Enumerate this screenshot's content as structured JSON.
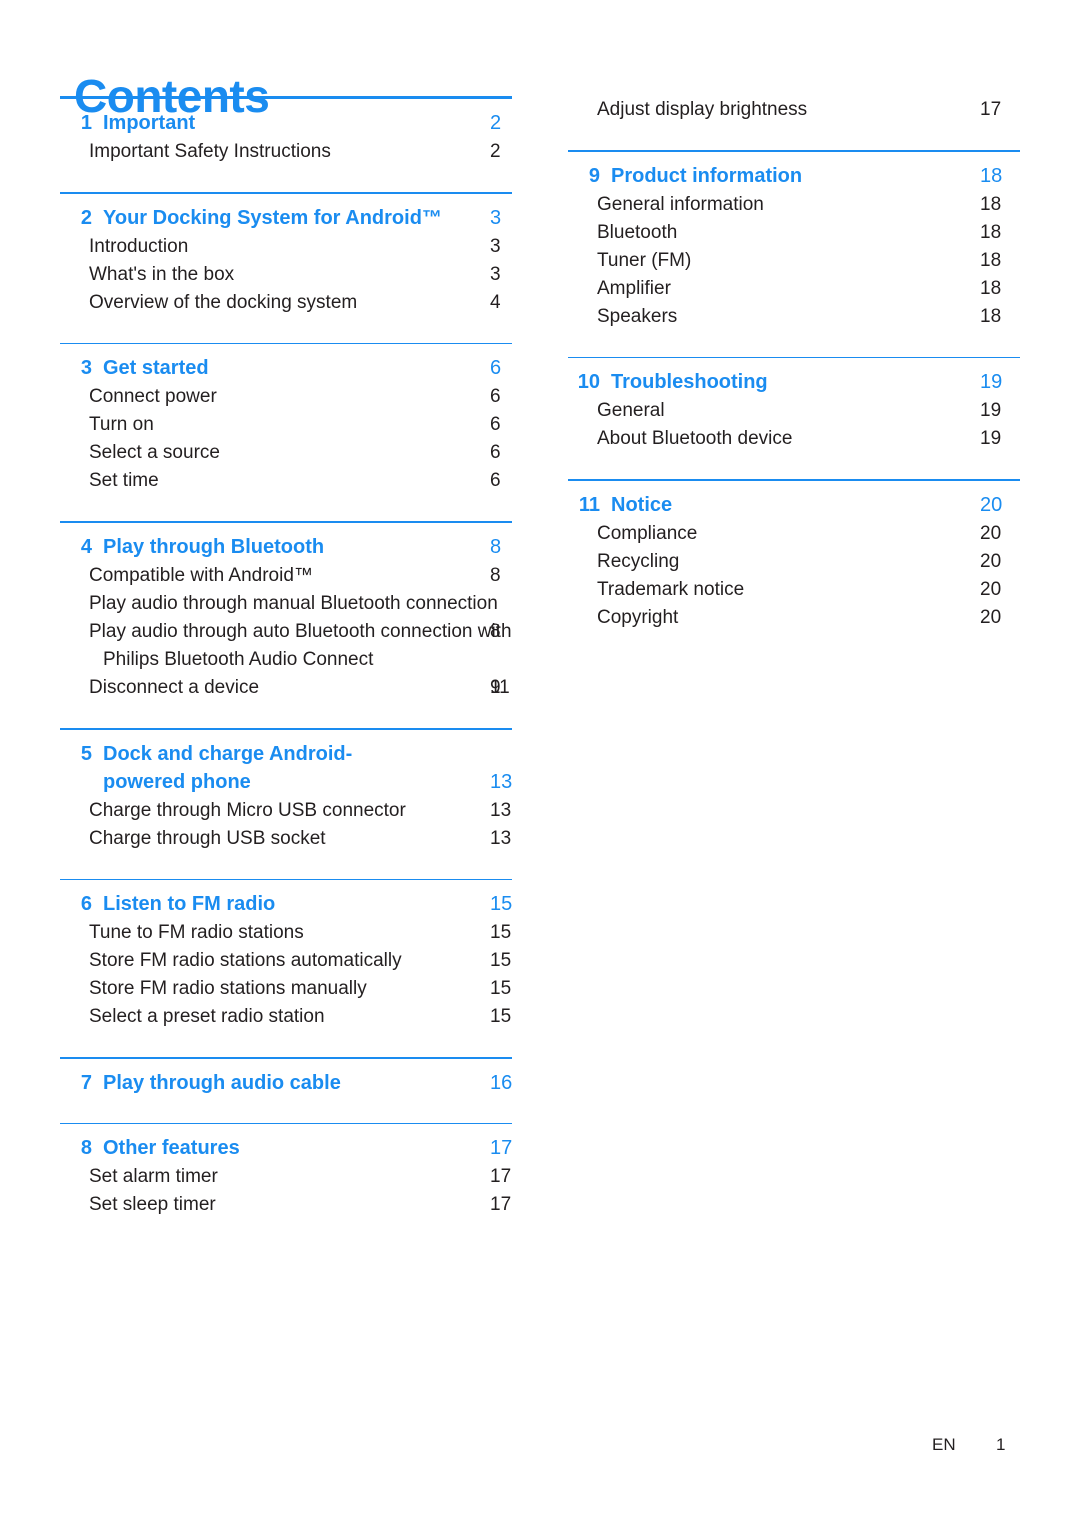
{
  "document": {
    "title": "Contents",
    "accent_color": "#1a8cf0",
    "text_color": "#231f20"
  },
  "footer": {
    "language": "EN",
    "page_number": "1"
  },
  "left_column": {
    "sections": [
      {
        "number": "1",
        "title": "Important",
        "page": "2",
        "entries": [
          {
            "label": "Important Safety Instructions",
            "page": "2"
          }
        ]
      },
      {
        "number": "2",
        "title": "Your Docking System for Android™",
        "page": "3",
        "entries": [
          {
            "label": "Introduction",
            "page": "3"
          },
          {
            "label": "What's in the box",
            "page": "3"
          },
          {
            "label": "Overview of the docking system",
            "page": "4"
          }
        ]
      },
      {
        "number": "3",
        "title": "Get started",
        "page": "6",
        "entries": [
          {
            "label": "Connect power",
            "page": "6"
          },
          {
            "label": "Turn on",
            "page": "6"
          },
          {
            "label": "Select a source",
            "page": "6"
          },
          {
            "label": "Set time",
            "page": "6"
          }
        ]
      },
      {
        "number": "4",
        "title": "Play through Bluetooth",
        "page": "8",
        "entries": [
          {
            "label": "Compatible with Android™",
            "page": "8"
          },
          {
            "label": "Play audio through manual Bluetooth connection",
            "page": "8",
            "lines": 2
          },
          {
            "label": "Play audio through auto Bluetooth connection with Philips Bluetooth Audio Connect",
            "page": "9",
            "lines": 3
          },
          {
            "label": "Disconnect a device",
            "page": "11"
          }
        ]
      },
      {
        "number": "5",
        "title": "Dock and charge Android-\npowered phone",
        "page": "13",
        "title_wraps": true,
        "entries": [
          {
            "label": "Charge through Micro USB connector",
            "page": "13"
          },
          {
            "label": "Charge through USB socket",
            "page": "13"
          }
        ]
      },
      {
        "number": "6",
        "title": "Listen to FM radio",
        "page": "15",
        "entries": [
          {
            "label": "Tune to FM radio stations",
            "page": "15"
          },
          {
            "label": "Store FM radio stations automatically",
            "page": "15"
          },
          {
            "label": "Store FM radio stations manually",
            "page": "15"
          },
          {
            "label": "Select a preset radio station",
            "page": "15"
          }
        ]
      },
      {
        "number": "7",
        "title": "Play through audio cable",
        "page": "16",
        "entries": []
      },
      {
        "number": "8",
        "title": "Other features",
        "page": "17",
        "entries": [
          {
            "label": "Set alarm timer",
            "page": "17"
          },
          {
            "label": "Set sleep timer",
            "page": "17"
          }
        ]
      }
    ]
  },
  "right_column": {
    "continued_entries": [
      {
        "label": "Adjust display brightness",
        "page": "17"
      }
    ],
    "sections": [
      {
        "number": "9",
        "title": "Product information",
        "page": "18",
        "entries": [
          {
            "label": "General information",
            "page": "18"
          },
          {
            "label": "Bluetooth",
            "page": "18"
          },
          {
            "label": "Tuner (FM)",
            "page": "18"
          },
          {
            "label": "Amplifier",
            "page": "18"
          },
          {
            "label": "Speakers",
            "page": "18"
          }
        ]
      },
      {
        "number": "10",
        "title": "Troubleshooting",
        "page": "19",
        "entries": [
          {
            "label": "General",
            "page": "19"
          },
          {
            "label": "About Bluetooth device",
            "page": "19"
          }
        ]
      },
      {
        "number": "11",
        "title": "Notice",
        "page": "20",
        "entries": [
          {
            "label": "Compliance",
            "page": "20"
          },
          {
            "label": "Recycling",
            "page": "20"
          },
          {
            "label": "Trademark notice",
            "page": "20"
          },
          {
            "label": "Copyright",
            "page": "20"
          }
        ]
      }
    ]
  }
}
